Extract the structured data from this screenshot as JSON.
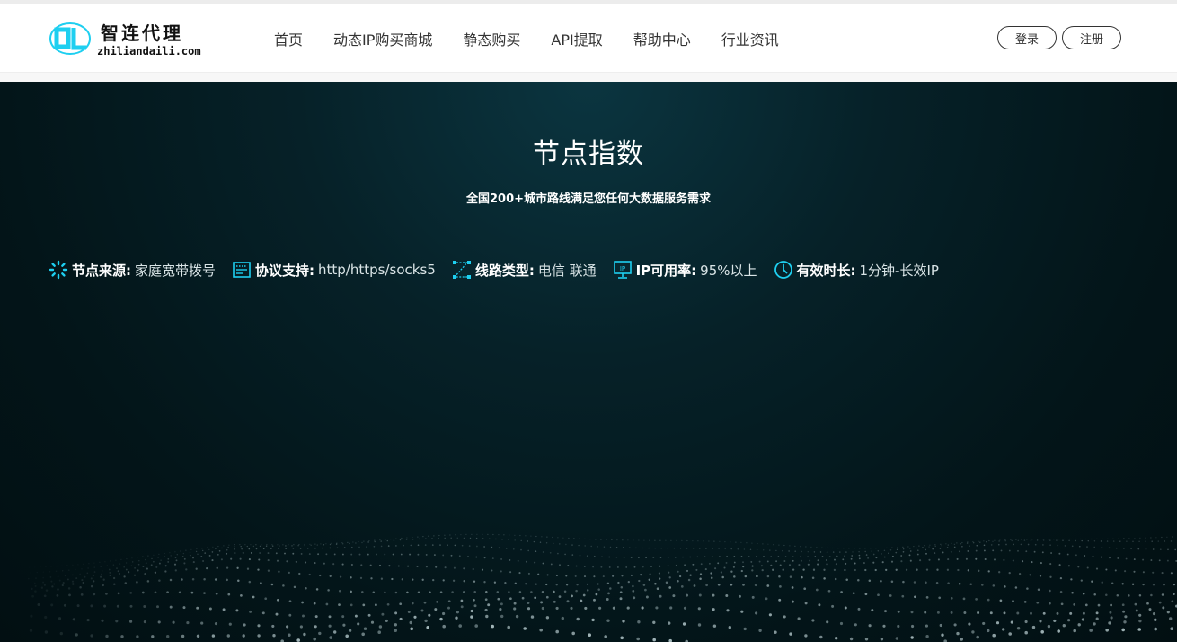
{
  "brand": {
    "logo_mark": "DL",
    "name_cn": "智连代理",
    "name_en": "zhiliandaili.com",
    "accent": "#1ecff0"
  },
  "nav": {
    "items": [
      {
        "label": "首页"
      },
      {
        "label": "动态IP购买商城"
      },
      {
        "label": "静态购买"
      },
      {
        "label": "API提取"
      },
      {
        "label": "帮助中心"
      },
      {
        "label": "行业资讯"
      }
    ]
  },
  "auth": {
    "login_label": "登录",
    "register_label": "注册"
  },
  "hero": {
    "title": "节点指数",
    "subtitle": "全国200+城市路线满足您任何大数据服务需求",
    "specs": [
      {
        "icon": "spinner-icon",
        "label": "节点来源:",
        "value": "家庭宽带拨号"
      },
      {
        "icon": "protocol-icon",
        "label": "协议支持:",
        "value": "http/https/socks5"
      },
      {
        "icon": "route-icon",
        "label": "线路类型:",
        "value": "电信 联通"
      },
      {
        "icon": "ip-monitor-icon",
        "label": "IP可用率:",
        "value": "95%以上"
      },
      {
        "icon": "clock-icon",
        "label": "有效时长:",
        "value": "1分钟-长效IP"
      }
    ],
    "background_color": "#031519",
    "icon_color": "#1ecff0"
  }
}
